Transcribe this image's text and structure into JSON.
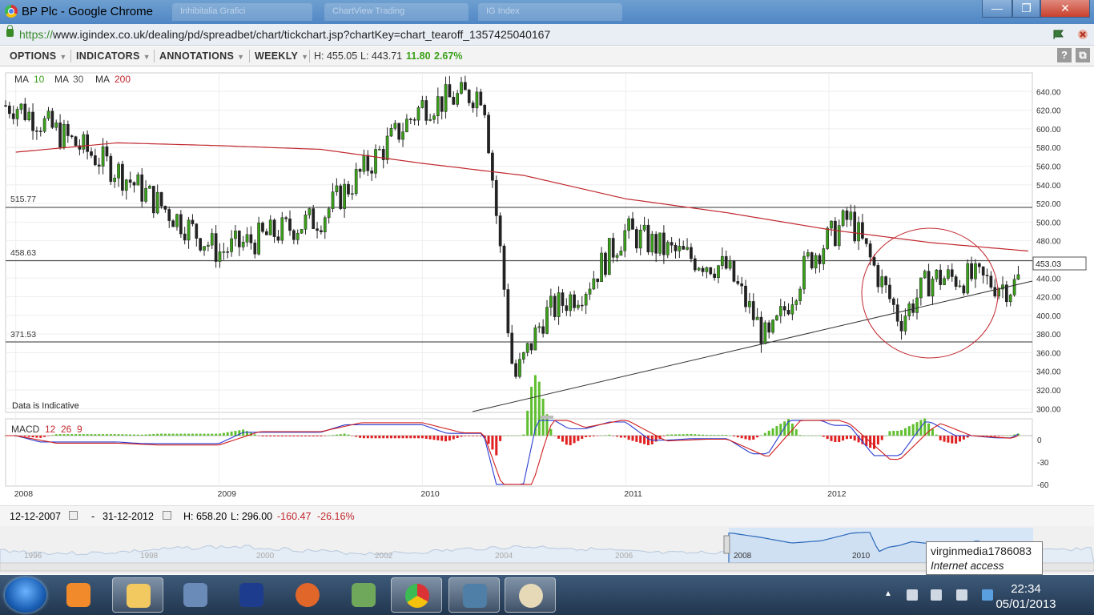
{
  "window": {
    "title": "BP Plc - Google Chrome",
    "tabs_ghost": [
      "Inhibitalia Grafici",
      "ChartView Trading",
      "IG Index"
    ],
    "minimize": "—",
    "maximize": "❐",
    "close": "✕"
  },
  "address": {
    "scheme": "https://",
    "rest": "www.igindex.co.uk/dealing/pd/spreadbet/chart/tickchart.jsp?chartKey=chart_tearoff_1357425040167"
  },
  "toolbar": {
    "options": "OPTIONS",
    "indicators": "INDICATORS",
    "annotations": "ANNOTATIONS",
    "interval": "WEEKLY",
    "high": "H: 455.05",
    "low": "L: 443.71",
    "change": "11.80",
    "change_pct": "2.67%",
    "help": "?",
    "detach": "⧉"
  },
  "legend": {
    "ma_label": "MA",
    "ma10": "10",
    "ma30": "30",
    "ma200": "200",
    "ma10_color": "#3aa019",
    "ma30_color": "#555555",
    "ma200_color": "#c0272d"
  },
  "chart": {
    "levels": [
      "515.77",
      "458.63",
      "371.53"
    ],
    "current_price": "453.03",
    "disclaimer": "Data is Indicative",
    "price_ticks": [
      "640.00",
      "620.00",
      "600.00",
      "580.00",
      "560.00",
      "540.00",
      "520.00",
      "500.00",
      "480.00",
      "460.00",
      "440.00",
      "420.00",
      "400.00",
      "380.00",
      "360.00",
      "340.00",
      "320.00",
      "300.00"
    ],
    "year_labels": [
      "2008",
      "2009",
      "2010",
      "2011",
      "2012"
    ],
    "macd_label": "MACD",
    "macd_params": [
      "12",
      "26",
      "9"
    ],
    "macd_ticks": [
      "0",
      "-30",
      "-60"
    ]
  },
  "chart_data": {
    "type": "candlestick",
    "title": "BP Plc",
    "interval": "WEEKLY",
    "ylim": [
      296,
      660
    ],
    "xlim": [
      "2007-12-12",
      "2012-12-31"
    ],
    "trend_x": [
      2008.0,
      2008.5,
      2009.0,
      2009.5,
      2010.0,
      2010.3,
      2010.45,
      2010.6,
      2010.8,
      2011.0,
      2011.2,
      2011.5,
      2011.7,
      2011.9,
      2012.1,
      2012.35,
      2012.5,
      2012.7,
      2012.9,
      2012.98
    ],
    "trend_close": [
      625,
      555,
      468,
      505,
      625,
      640,
      330,
      400,
      430,
      490,
      470,
      450,
      370,
      460,
      505,
      395,
      440,
      440,
      430,
      453
    ],
    "ma200_x": [
      2008.0,
      2008.5,
      2009.0,
      2009.5,
      2010.0,
      2010.5,
      2011.0,
      2011.5,
      2012.0,
      2012.5,
      2012.98
    ],
    "ma200": [
      575,
      585,
      582,
      578,
      563,
      550,
      525,
      510,
      492,
      478,
      469
    ],
    "support_lines": [
      515.77,
      458.63,
      371.53
    ],
    "macd_ylim": [
      -60,
      20
    ]
  },
  "range": {
    "from": "12-12-2007",
    "to": "31-12-2012",
    "dash": "-",
    "high": "H: 658.20",
    "low": "L: 296.00",
    "change": "-160.47",
    "change_pct": "-26.16%"
  },
  "navigator": {
    "years": [
      "1996",
      "1998",
      "2000",
      "2002",
      "2004",
      "2006",
      "2008",
      "2010"
    ]
  },
  "tooltip": {
    "user": "virginmedia1786083",
    "zone": "Internet access"
  },
  "taskbar": {
    "time": "22:34",
    "date": "05/01/2013"
  }
}
